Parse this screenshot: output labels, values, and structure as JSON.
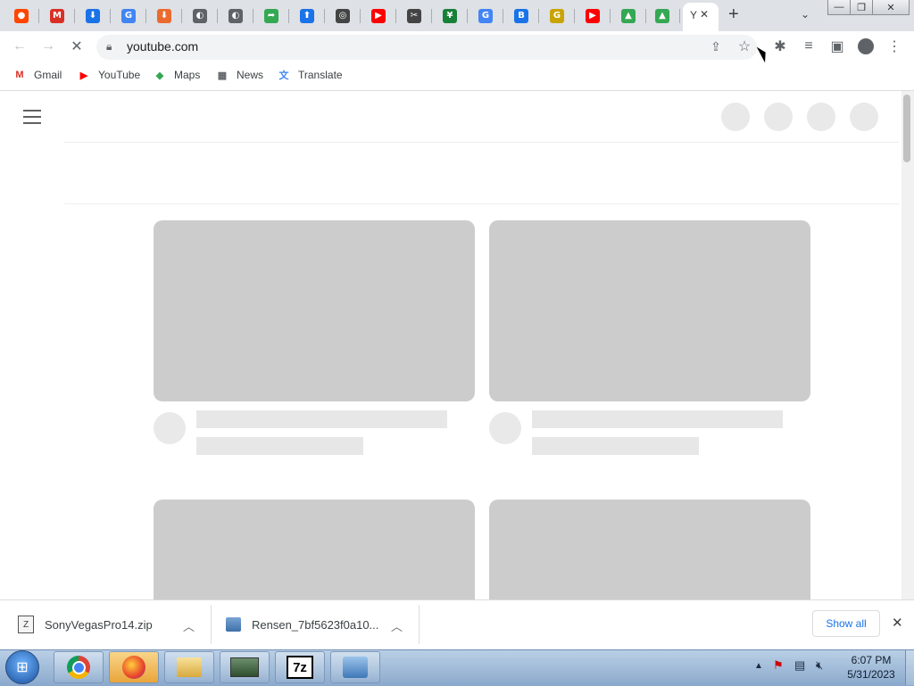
{
  "tabs": [
    {
      "icon": "reddit-icon",
      "glyph": "●",
      "color": "#ff4500"
    },
    {
      "icon": "gmail-m-icon",
      "glyph": "M",
      "color": "#d93025"
    },
    {
      "icon": "download-icon",
      "glyph": "⬇",
      "color": "#1a73e8"
    },
    {
      "icon": "google-g-icon",
      "glyph": "G",
      "color": "#4285f4"
    },
    {
      "icon": "download-orange-icon",
      "glyph": "⬇",
      "color": "#ea6b2d"
    },
    {
      "icon": "globe-icon",
      "glyph": "◐",
      "color": "#5f6368"
    },
    {
      "icon": "globe-icon",
      "glyph": "◐",
      "color": "#5f6368"
    },
    {
      "icon": "share-green-icon",
      "glyph": "➦",
      "color": "#34a853"
    },
    {
      "icon": "upload-icon",
      "glyph": "⬆",
      "color": "#1a73e8"
    },
    {
      "icon": "chrome-icon",
      "glyph": "◎",
      "color": "#444"
    },
    {
      "icon": "youtube-icon",
      "glyph": "▶",
      "color": "#ff0000"
    },
    {
      "icon": "tool-icon",
      "glyph": "✂",
      "color": "#444"
    },
    {
      "icon": "green-sheet-icon",
      "glyph": "¥",
      "color": "#188038"
    },
    {
      "icon": "google-g-icon",
      "glyph": "G",
      "color": "#4285f4"
    },
    {
      "icon": "shield-b-icon",
      "glyph": "B",
      "color": "#1a73e8"
    },
    {
      "icon": "grammarly-g-icon",
      "glyph": "G",
      "color": "#c9a400"
    },
    {
      "icon": "youtube-icon",
      "glyph": "▶",
      "color": "#ff0000"
    },
    {
      "icon": "google-drive-icon",
      "glyph": "▲",
      "color": "#34a853"
    },
    {
      "icon": "google-drive-icon",
      "glyph": "▲",
      "color": "#34a853"
    }
  ],
  "active_tab": {
    "title": "Y",
    "close": "✕"
  },
  "new_tab": "+",
  "url": "youtube.com",
  "bookmarks": [
    {
      "label": "Gmail",
      "icon": "gmail-icon",
      "glyph": "M",
      "color": "#d93025"
    },
    {
      "label": "YouTube",
      "icon": "youtube-icon",
      "glyph": "▶",
      "color": "#ff0000"
    },
    {
      "label": "Maps",
      "icon": "maps-icon",
      "glyph": "◆",
      "color": "#34a853"
    },
    {
      "label": "News",
      "icon": "news-icon",
      "glyph": "▦",
      "color": "#5f6368"
    },
    {
      "label": "Translate",
      "icon": "translate-icon",
      "glyph": "文",
      "color": "#4285f4"
    }
  ],
  "downloads": [
    {
      "name": "SonyVegasPro14.zip",
      "icon": "zip-file-icon"
    },
    {
      "name": "Rensen_7bf5623f0a10...",
      "icon": "installer-file-icon"
    }
  ],
  "show_all": "Show all",
  "clock": {
    "time": "6:07 PM",
    "date": "5/31/2023"
  },
  "taskbar_apps": [
    {
      "icon": "chrome-icon"
    },
    {
      "icon": "firefox-icon"
    },
    {
      "icon": "file-explorer-icon"
    },
    {
      "icon": "network-monitor-icon"
    },
    {
      "icon": "7zip-icon",
      "label": "7z"
    },
    {
      "icon": "control-panel-icon"
    }
  ]
}
